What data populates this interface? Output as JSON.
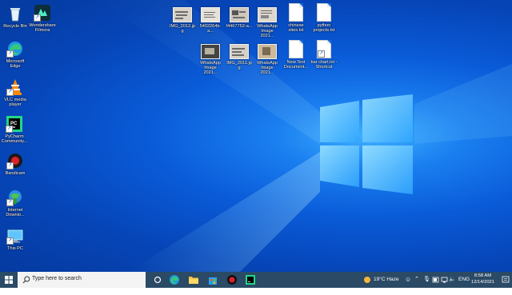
{
  "desktop_icons": {
    "recycle_bin": "Recycle Bin",
    "filmora": "Wondershare Filmora",
    "edge": "Microsoft Edge",
    "vlc": "VLC media player",
    "pycharm": "PyCharm Community...",
    "bandicam": "Bandicam",
    "idm": "Internet Downlo...",
    "this_pc": "This PC"
  },
  "files": {
    "row1": [
      "IMG_2012.jpg",
      "5402264b-a...",
      "f4467752-a...",
      "WhatsApp Image 2021...",
      "chinese sites.txt",
      "python projects.txt"
    ],
    "row2": [
      "WhatsApp Image 2021...",
      "IMG_2011.jpg",
      "WhatsApp Image 2021...",
      "New Text Document...",
      "bar chart.txt - Shortcut"
    ]
  },
  "taskbar": {
    "search_placeholder": "Type here to search",
    "weather": "19°C  Haze",
    "language": "ENG",
    "time": "8:58 AM",
    "date": "12/14/2021"
  },
  "colors": {
    "desktop_blue": "#0a5bd8",
    "taskbar": "#2a4a66",
    "accent_logo": "#6fd0ff"
  }
}
